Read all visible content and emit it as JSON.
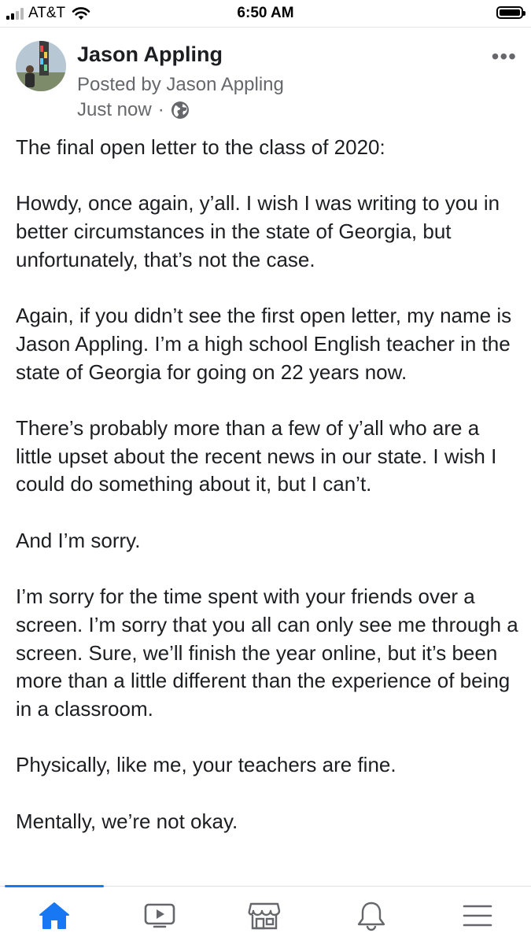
{
  "status_bar": {
    "carrier": "AT&T",
    "time": "6:50 AM"
  },
  "post": {
    "author": "Jason Appling",
    "posted_by": "Posted by Jason Appling",
    "timestamp": "Just now",
    "separator": "·",
    "more_label": "•••",
    "paragraphs": [
      "The final open letter to the class of 2020:",
      "Howdy, once again, y’all. I wish I was writing to you in better circumstances in the state of Georgia, but unfortunately, that’s not the case.",
      "Again, if you didn’t see the first open letter, my name is Jason Appling. I’m a high school English teacher in the state of Georgia for going on 22 years now.",
      "There’s probably more than a few of y’all who are a little upset about the recent news in our state. I wish I could do something about it, but I can’t.",
      "And I’m sorry.",
      "I’m sorry for the time spent with your friends over a screen. I’m sorry that you all can only see me through a screen. Sure, we’ll finish the year online, but it’s been more than a little different than the experience of being in a classroom.",
      "Physically, like me, your teachers are fine.",
      "Mentally, we’re not okay."
    ]
  },
  "nav": {
    "items": [
      "home-icon",
      "watch-icon",
      "marketplace-icon",
      "notifications-icon",
      "menu-icon"
    ],
    "active": "home-icon",
    "accent": "#1877f2",
    "icon_color": "#65676b"
  }
}
